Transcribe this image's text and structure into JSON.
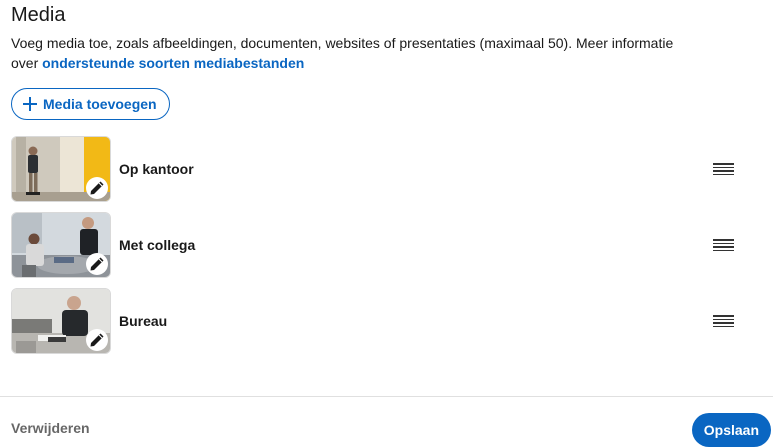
{
  "section": {
    "title": "Media",
    "description_prefix": "Voeg media toe, zoals afbeeldingen, documenten, websites of presentaties (maximaal 50). Meer informatie over ",
    "link_text": "ondersteunde soorten mediabestanden"
  },
  "add_button": {
    "label": "Media toevoegen",
    "icon": "plus-icon"
  },
  "media_items": [
    {
      "label": "Op kantoor",
      "edit_icon": "pencil-icon",
      "drag_icon": "drag-handle-icon"
    },
    {
      "label": "Met collega",
      "edit_icon": "pencil-icon",
      "drag_icon": "drag-handle-icon"
    },
    {
      "label": "Bureau",
      "edit_icon": "pencil-icon",
      "drag_icon": "drag-handle-icon"
    }
  ],
  "footer": {
    "remove_label": "Verwijderen",
    "save_label": "Opslaan"
  },
  "colors": {
    "accent": "#0a66c2",
    "text": "#191919",
    "muted": "#666666"
  }
}
